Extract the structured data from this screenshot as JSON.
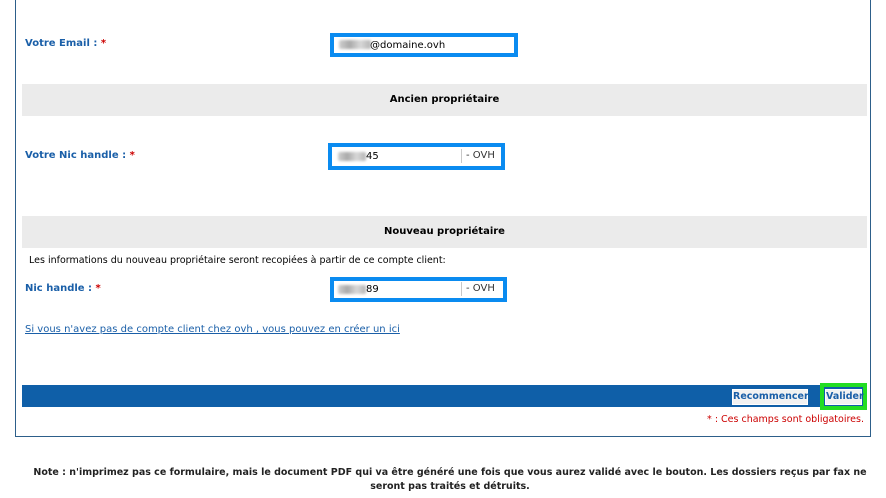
{
  "email": {
    "label": "Votre Email :",
    "required_mark": "*",
    "value": "@domaine.ovh"
  },
  "old_owner": {
    "title": "Ancien propriétaire",
    "nic_label": "Votre Nic handle :",
    "required_mark": "*",
    "nic_value": "45",
    "suffix": "- OVH"
  },
  "new_owner": {
    "title": "Nouveau propriétaire",
    "info": "Les informations du nouveau propriétaire seront recopiées à partir de ce compte client:",
    "nic_label": "Nic handle :",
    "required_mark": "*",
    "nic_value": "89",
    "suffix": "- OVH"
  },
  "create_account_link": "Si vous n'avez pas de compte client chez ovh , vous pouvez en créer un ici",
  "buttons": {
    "reset": "Recommencer",
    "submit": "Valider"
  },
  "mandatory_note": "* : Ces champs sont obligatoires.",
  "footer_note": "Note : n'imprimez pas ce formulaire, mais le document PDF qui va être généré une fois que vous aurez validé avec le bouton. Les dossiers reçus par fax ne seront pas traités et détruits.",
  "colors": {
    "label_blue": "#1a5fa8",
    "highlight_blue": "#0a8bf0",
    "highlight_green": "#22dd22",
    "bar_blue": "#0f5fa8",
    "required_red": "#cc0000"
  }
}
